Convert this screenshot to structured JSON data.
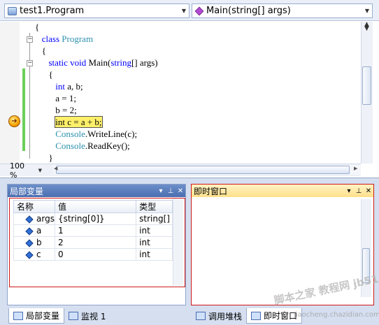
{
  "editor": {
    "type_combo": "test1.Program",
    "member_combo": "Main(string[] args)",
    "zoom": "100 %",
    "code_lines": [
      {
        "indent": 0,
        "parts": [
          {
            "t": "{",
            "c": "p"
          }
        ]
      },
      {
        "indent": 1,
        "parts": [
          {
            "t": "class ",
            "c": "kw"
          },
          {
            "t": "Program",
            "c": "ty"
          }
        ]
      },
      {
        "indent": 1,
        "parts": [
          {
            "t": "{",
            "c": "p"
          }
        ]
      },
      {
        "indent": 2,
        "parts": [
          {
            "t": "static void ",
            "c": "kw"
          },
          {
            "t": "Main(",
            "c": "p"
          },
          {
            "t": "string",
            "c": "kw"
          },
          {
            "t": "[] args)",
            "c": "p"
          }
        ]
      },
      {
        "indent": 2,
        "parts": [
          {
            "t": "{",
            "c": "p"
          }
        ]
      },
      {
        "indent": 3,
        "parts": [
          {
            "t": "int",
            "c": "kw"
          },
          {
            "t": " a, b;",
            "c": "p"
          }
        ]
      },
      {
        "indent": 3,
        "parts": [
          {
            "t": "a = 1;",
            "c": "p"
          }
        ]
      },
      {
        "indent": 3,
        "parts": [
          {
            "t": "b = 2;",
            "c": "p"
          }
        ]
      },
      {
        "indent": 3,
        "highlight": true,
        "parts": [
          {
            "t": "int c = a + b;",
            "c": "p"
          }
        ]
      },
      {
        "indent": 3,
        "parts": [
          {
            "t": "Console",
            "c": "ty"
          },
          {
            "t": ".WriteLine(c);",
            "c": "p"
          }
        ]
      },
      {
        "indent": 3,
        "parts": [
          {
            "t": "Console",
            "c": "ty"
          },
          {
            "t": ".ReadKey();",
            "c": "p"
          }
        ]
      },
      {
        "indent": 2,
        "parts": [
          {
            "t": "}",
            "c": "p"
          }
        ]
      }
    ]
  },
  "locals": {
    "title": "局部变量",
    "columns": [
      "名称",
      "值",
      "类型"
    ],
    "rows": [
      {
        "name": "args",
        "value": "{string[0]}",
        "type": "string[]"
      },
      {
        "name": "a",
        "value": "1",
        "type": "int"
      },
      {
        "name": "b",
        "value": "2",
        "type": "int"
      },
      {
        "name": "c",
        "value": "0",
        "type": "int"
      }
    ]
  },
  "immediate": {
    "title": "即时窗口"
  },
  "bottom_tabs": {
    "locals": "局部变量",
    "watch": "监视 1",
    "callstack": "调用堆栈",
    "immediate": "即时窗口"
  },
  "watermark": {
    "main": "脚本之家 教程网",
    "site": "jb51.net",
    "url": "jiaocheng.chazidian.com"
  },
  "colors": {
    "keyword": "#0000ff",
    "type": "#2b91af",
    "current_line": "#fff06a",
    "change_bar": "#6ccf5a",
    "active_title": "#4a6db0",
    "immediate_title": "#ffe08a"
  }
}
